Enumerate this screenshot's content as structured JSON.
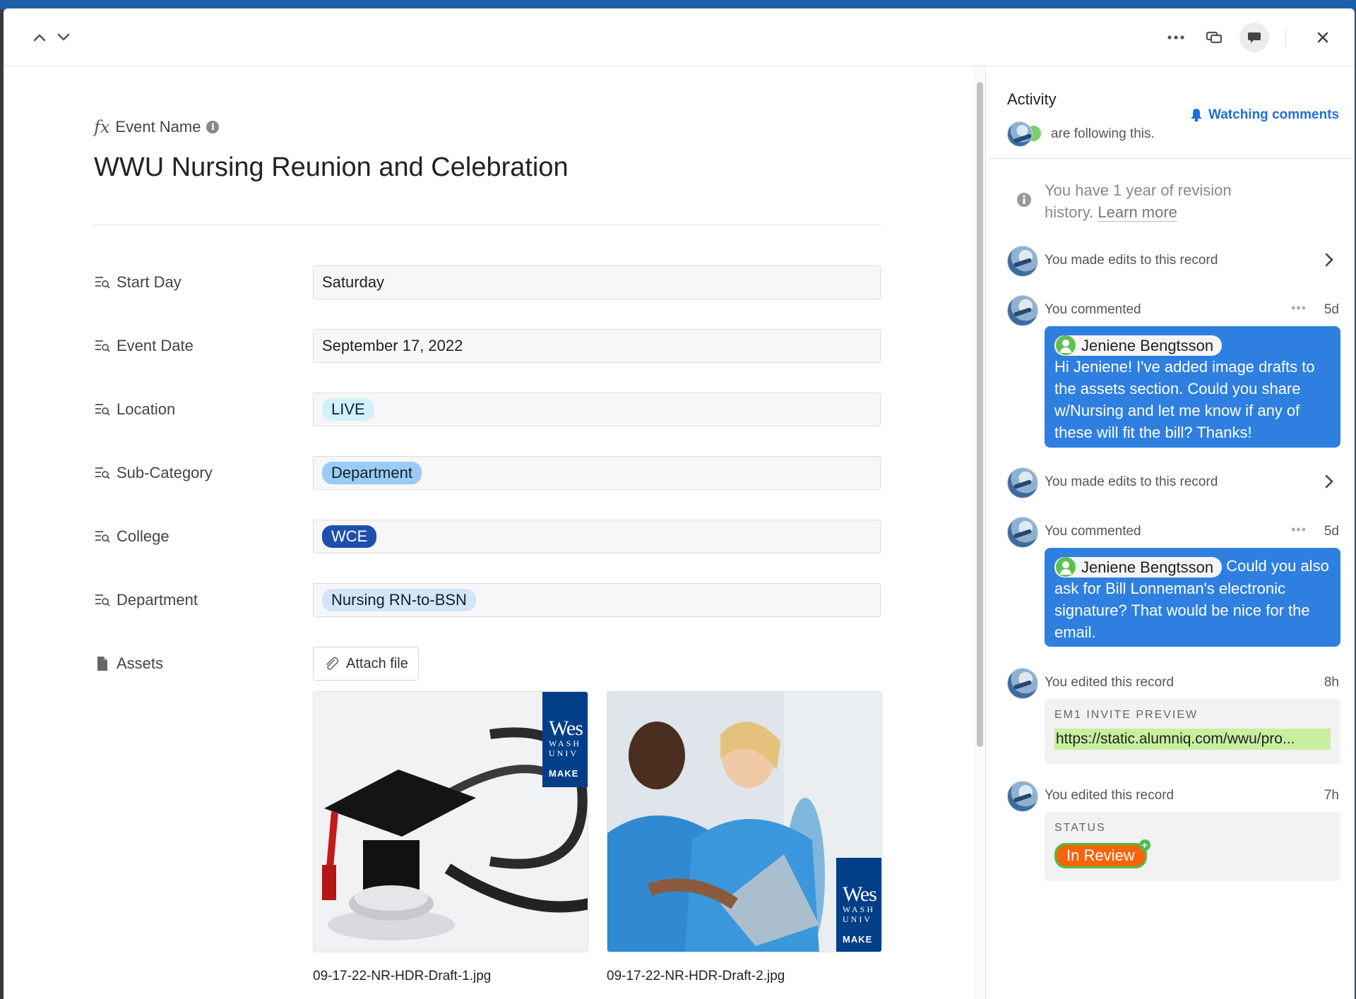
{
  "colors": {
    "accent": "#2e7fe0",
    "status_orange": "#f7640c",
    "url_green": "#c7ef9f"
  },
  "toolbar": {
    "prev_icon": "chevron-up-icon",
    "next_icon": "chevron-down-icon",
    "more_icon": "ellipsis-icon",
    "expand_icon": "expand-icon",
    "comments_icon": "comment-icon",
    "close_icon": "close-icon"
  },
  "record": {
    "field_label": "Event Name",
    "title": "WWU Nursing Reunion and Celebration",
    "fields": [
      {
        "label": "Start Day",
        "value": "Saturday"
      },
      {
        "label": "Event Date",
        "value": "September 17, 2022"
      },
      {
        "label": "Location",
        "value": "LIVE",
        "pill_color": "#d0f1fb"
      },
      {
        "label": "Sub-Category",
        "value": "Department",
        "pill_color": "#9ccbf5"
      },
      {
        "label": "College",
        "value": "WCE",
        "pill_color": "#1f4fae"
      },
      {
        "label": "Department",
        "value": "Nursing RN-to-BSN",
        "pill_color": "#d2e6fb"
      }
    ],
    "assets": {
      "label": "Assets",
      "attach_label": "Attach file",
      "files": [
        {
          "name": "09-17-22-NR-HDR-Draft-1.jpg",
          "badge_big": "Wes",
          "badge_sm1": "WASH",
          "badge_sm2": "UNIV",
          "badge_mk": "MAKE"
        },
        {
          "name": "09-17-22-NR-HDR-Draft-2.jpg",
          "badge_big": "Wes",
          "badge_sm1": "WASH",
          "badge_sm2": "UNIV",
          "badge_mk": "MAKE"
        }
      ]
    }
  },
  "activity": {
    "title": "Activity",
    "watching": "Watching comments",
    "following": "are following this.",
    "revision_text": "You have 1 year of revision history.",
    "revision_link": "Learn more",
    "events": [
      {
        "type": "edit",
        "text": "You made edits to this record"
      },
      {
        "type": "comment",
        "text": "You commented",
        "time": "5d",
        "mention": "Jeniene Bengtsson",
        "body": "Hi Jeniene! I've added image drafts to the assets section. Could you share w/Nursing and let me know if any of these will fit the bill? Thanks!"
      },
      {
        "type": "edit",
        "text": "You made edits to this record"
      },
      {
        "type": "comment",
        "text": "You commented",
        "time": "5d",
        "mention": "Jeniene Bengtsson",
        "body": "Could you also ask for Bill Lonneman's electronic signature? That would be nice for the email."
      },
      {
        "type": "field",
        "text": "You edited this record",
        "time": "8h",
        "field": "EM1 INVITE PREVIEW",
        "value": "https://static.alumniq.com/wwu/pro..."
      },
      {
        "type": "field",
        "text": "You edited this record",
        "time": "7h",
        "field": "STATUS",
        "value": "In Review"
      }
    ]
  }
}
